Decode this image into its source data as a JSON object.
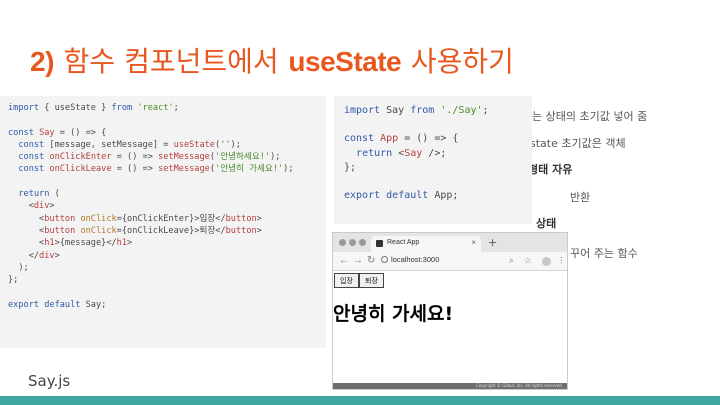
{
  "slide": {
    "title_num": "2)",
    "title_a": "함수 컴포넌트에서",
    "title_b": "useState",
    "title_c": "사용하기",
    "filename": "Say.js",
    "accent": "#e8571e",
    "band_color": "#3fa6a0"
  },
  "code_left": {
    "lines": [
      "import { useState } from 'react';",
      "",
      "const Say = () => {",
      "  const [message, setMessage] = useState('');",
      "  const onClickEnter = () => setMessage('안녕하세요!');",
      "  const onClickLeave = () => setMessage('안녕히 가세요!');",
      "",
      "  return (",
      "    <div>",
      "      <button onClick={onClickEnter}>입장</button>",
      "      <button onClick={onClickLeave}>퇴장</button>",
      "      <h1>{message}</h1>",
      "    </div>",
      "  );",
      "};",
      "",
      "export default Say;"
    ]
  },
  "code_right": {
    "lines": [
      "import Say from './Say';",
      "",
      "const App = () => {",
      "  return <Say />;",
      "};",
      "",
      "export default App;"
    ]
  },
  "bullets": {
    "b1": "는 상태의 초기값 넣어 줌",
    "b2": "state 초기값은 객체",
    "b3": "형태 자유",
    "b4": "반환",
    "b5": "상태",
    "b6": "꾸어 주는 함수"
  },
  "browser": {
    "tab_title": "React App",
    "tab_close": "×",
    "new_tab": "+",
    "url": "localhost:3000",
    "enter_button": "입장",
    "leave_button": "퇴장",
    "message": "안녕히 가세요!",
    "footer": "Copyright © Gilbut, Inc. All rights reserved."
  }
}
